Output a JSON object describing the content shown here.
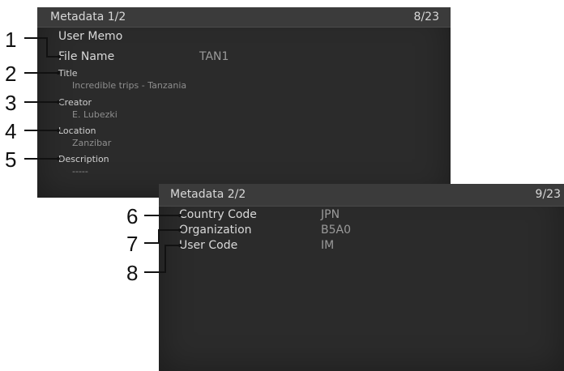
{
  "screen1": {
    "title": "Metadata 1/2",
    "counter": "8/23",
    "user_memo": "User Memo",
    "file_name_label": "File Name",
    "file_name_value": "TAN1",
    "title_label": "Title",
    "title_value": "Incredible trips - Tanzania",
    "creator_label": "Creator",
    "creator_value": "E. Lubezki",
    "location_label": "Location",
    "location_value": "Zanzibar",
    "description_label": "Description",
    "description_value": "-----"
  },
  "screen2": {
    "title": "Metadata 2/2",
    "counter": "9/23",
    "country_label": "Country Code",
    "country_value": "JPN",
    "organization_label": "Organization",
    "organization_value": "B5A0",
    "user_code_label": "User Code",
    "user_code_value": "IM"
  },
  "callouts": [
    "1",
    "2",
    "3",
    "4",
    "5",
    "6",
    "7",
    "8"
  ]
}
